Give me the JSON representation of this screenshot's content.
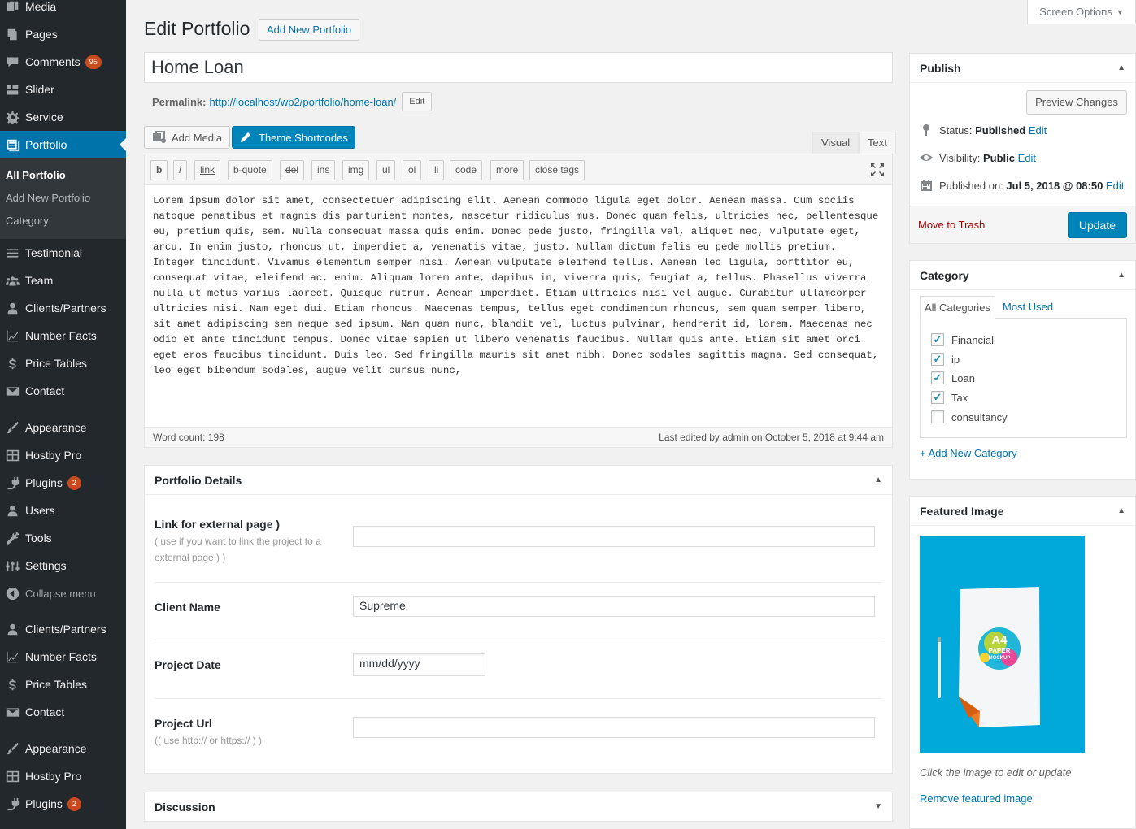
{
  "sidebar": {
    "items": [
      {
        "label": "Media",
        "icon": "media-icon"
      },
      {
        "label": "Pages",
        "icon": "pages-icon"
      },
      {
        "label": "Comments",
        "icon": "comments-icon",
        "badge": "95"
      },
      {
        "label": "Slider",
        "icon": "slider-icon"
      },
      {
        "label": "Service",
        "icon": "gear-icon"
      },
      {
        "label": "Portfolio",
        "icon": "portfolio-icon"
      },
      {
        "label": "Testimonial",
        "icon": "list-icon"
      },
      {
        "label": "Team",
        "icon": "team-icon"
      },
      {
        "label": "Clients/Partners",
        "icon": "user-icon"
      },
      {
        "label": "Number Facts",
        "icon": "chart-icon"
      },
      {
        "label": "Price Tables",
        "icon": "dollar-icon"
      },
      {
        "label": "Contact",
        "icon": "mail-icon"
      },
      {
        "label": "Appearance",
        "icon": "brush-icon"
      },
      {
        "label": "Hostby Pro",
        "icon": "grid-icon"
      },
      {
        "label": "Plugins",
        "icon": "plug-icon",
        "badge": "2"
      },
      {
        "label": "Users",
        "icon": "user-icon"
      },
      {
        "label": "Tools",
        "icon": "wrench-icon"
      },
      {
        "label": "Settings",
        "icon": "settings-icon"
      },
      {
        "label": "Collapse menu",
        "icon": "collapse-icon"
      },
      {
        "label": "Clients/Partners",
        "icon": "user-icon"
      },
      {
        "label": "Number Facts",
        "icon": "chart-icon"
      },
      {
        "label": "Price Tables",
        "icon": "dollar-icon"
      },
      {
        "label": "Contact",
        "icon": "mail-icon"
      },
      {
        "label": "Appearance",
        "icon": "brush-icon"
      },
      {
        "label": "Hostby Pro",
        "icon": "grid-icon"
      },
      {
        "label": "Plugins",
        "icon": "plug-icon",
        "badge": "2"
      }
    ],
    "submenu": [
      "All Portfolio",
      "Add New Portfolio",
      "Category"
    ]
  },
  "screen_options": "Screen Options",
  "header": {
    "title": "Edit Portfolio",
    "add_new": "Add New Portfolio"
  },
  "post": {
    "title": "Home Loan",
    "permalink_label": "Permalink:",
    "permalink_url": "http://localhost/wp2/portfolio/home-loan/",
    "permalink_edit": "Edit"
  },
  "editor": {
    "add_media": "Add Media",
    "theme_shortcodes": "Theme Shortcodes",
    "tab_visual": "Visual",
    "tab_text": "Text",
    "quicktags": [
      "b",
      "i",
      "link",
      "b-quote",
      "del",
      "ins",
      "img",
      "ul",
      "ol",
      "li",
      "code",
      "more",
      "close tags"
    ],
    "content": "Lorem ipsum dolor sit amet, consectetuer adipiscing elit. Aenean commodo ligula eget dolor. Aenean massa. Cum sociis natoque penatibus et magnis dis parturient montes, nascetur ridiculus mus. Donec quam felis, ultricies nec, pellentesque eu, pretium quis, sem. Nulla consequat massa quis enim. Donec pede justo, fringilla vel, aliquet nec, vulputate eget, arcu. In enim justo, rhoncus ut, imperdiet a, venenatis vitae, justo. Nullam dictum felis eu pede mollis pretium. Integer tincidunt. Vivamus elementum semper nisi. Aenean vulputate eleifend tellus. Aenean leo ligula, porttitor eu, consequat vitae, eleifend ac, enim. Aliquam lorem ante, dapibus in, viverra quis, feugiat a, tellus. Phasellus viverra nulla ut metus varius laoreet. Quisque rutrum. Aenean imperdiet. Etiam ultricies nisi vel augue. Curabitur ullamcorper ultricies nisi. Nam eget dui. Etiam rhoncus. Maecenas tempus, tellus eget condimentum rhoncus, sem quam semper libero, sit amet adipiscing sem neque sed ipsum. Nam quam nunc, blandit vel, luctus pulvinar, hendrerit id, lorem. Maecenas nec odio et ante tincidunt tempus. Donec vitae sapien ut libero venenatis faucibus. Nullam quis ante. Etiam sit amet orci eget eros faucibus tincidunt. Duis leo. Sed fringilla mauris sit amet nibh. Donec sodales sagittis magna. Sed consequat, leo eget bibendum sodales, augue velit cursus nunc,",
    "word_count": "Word count: 198",
    "last_edited": "Last edited by admin on October 5, 2018 at 9:44 am"
  },
  "portfolio_details": {
    "title": "Portfolio Details",
    "link_label": "Link for external page )",
    "link_desc": "( use if you want to link the project to a external page ) )",
    "link_value": "",
    "client_label": "Client Name",
    "client_value": "Supreme",
    "date_label": "Project Date",
    "date_placeholder": "mm/dd/yyyy",
    "url_label": "Project Url",
    "url_desc": "(( use http:// or https:// ) )",
    "url_value": ""
  },
  "discussion": {
    "title": "Discussion"
  },
  "publish": {
    "title": "Publish",
    "preview": "Preview Changes",
    "status_label": "Status:",
    "status_value": "Published",
    "visibility_label": "Visibility:",
    "visibility_value": "Public",
    "published_label": "Published on:",
    "published_value": "Jul 5, 2018 @ 08:50",
    "edit": "Edit",
    "trash": "Move to Trash",
    "update": "Update"
  },
  "category": {
    "title": "Category",
    "tab_all": "All Categories",
    "tab_most": "Most Used",
    "items": [
      {
        "label": "Financial",
        "checked": true
      },
      {
        "label": "ip",
        "checked": true
      },
      {
        "label": "Loan",
        "checked": true
      },
      {
        "label": "Tax",
        "checked": true
      },
      {
        "label": "consultancy",
        "checked": false
      }
    ],
    "add_new": "+ Add New Category"
  },
  "featured": {
    "title": "Featured Image",
    "hint": "Click the image to edit or update",
    "remove": "Remove featured image",
    "image_text": [
      "A4",
      "PAPER",
      "MOCKUP"
    ]
  },
  "colors": {
    "accent": "#0073aa",
    "button": "#0085ba",
    "sidebar": "#23282d",
    "trash": "#a00",
    "badge": "#ca4a1f"
  }
}
